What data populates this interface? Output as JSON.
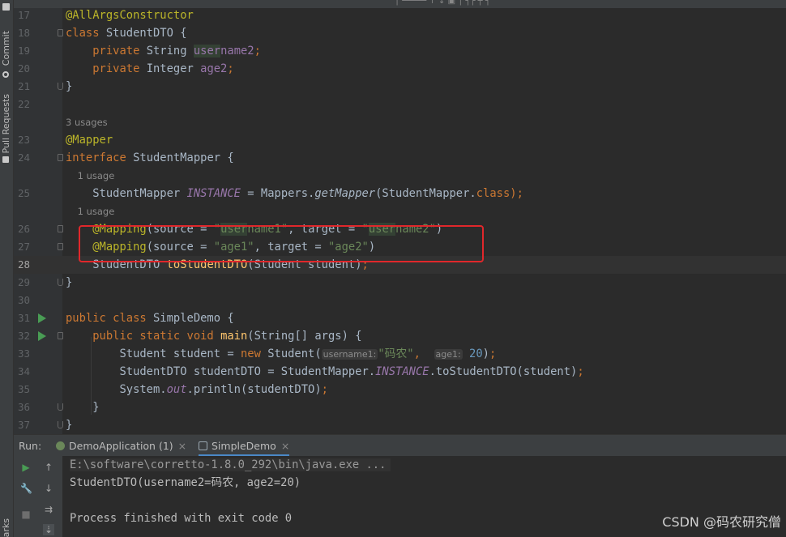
{
  "sidebar": {
    "commit_label": "Commit",
    "pull_requests_label": "Pull Requests",
    "bookmarks_label": "arks"
  },
  "editor": {
    "lines": [
      {
        "num": "17",
        "tokens": [
          {
            "t": "@AllArgsConstructor",
            "c": "ann"
          }
        ]
      },
      {
        "num": "18",
        "tokens": [
          {
            "t": "class ",
            "c": "kw"
          },
          {
            "t": "StudentDTO {"
          }
        ]
      },
      {
        "num": "19",
        "tokens": [
          {
            "t": "    private ",
            "c": "kw"
          },
          {
            "t": "String "
          },
          {
            "t": "user",
            "c": "field hl"
          },
          {
            "t": "name2",
            "c": "field"
          },
          {
            "t": ";",
            "c": "kw"
          }
        ]
      },
      {
        "num": "20",
        "tokens": [
          {
            "t": "    private ",
            "c": "kw"
          },
          {
            "t": "Integer "
          },
          {
            "t": "age2",
            "c": "field"
          },
          {
            "t": ";",
            "c": "kw"
          }
        ]
      },
      {
        "num": "21",
        "tokens": [
          {
            "t": "}"
          }
        ]
      },
      {
        "num": "22",
        "tokens": []
      },
      {
        "hint": "3 usages"
      },
      {
        "num": "23",
        "tokens": [
          {
            "t": "@Mapper",
            "c": "ann"
          }
        ]
      },
      {
        "num": "24",
        "tokens": [
          {
            "t": "interface ",
            "c": "kw"
          },
          {
            "t": "StudentMapper {"
          }
        ]
      },
      {
        "hint": "    1 usage"
      },
      {
        "num": "25",
        "tokens": [
          {
            "t": "    StudentMapper "
          },
          {
            "t": "INSTANCE",
            "c": "static"
          },
          {
            "t": " = Mappers."
          },
          {
            "t": "getMapper",
            "c": "it"
          },
          {
            "t": "(StudentMapper."
          },
          {
            "t": "class",
            "c": "kw"
          },
          {
            "t": ");",
            "c": "kw"
          }
        ]
      },
      {
        "hint": "    1 usage"
      },
      {
        "num": "26",
        "tokens": [
          {
            "t": "    @Mapping",
            "c": "ann"
          },
          {
            "t": "(source = "
          },
          {
            "t": "\"",
            "c": "str"
          },
          {
            "t": "user",
            "c": "str hl"
          },
          {
            "t": "name1\"",
            "c": "str"
          },
          {
            "t": ", target = "
          },
          {
            "t": "\"",
            "c": "str"
          },
          {
            "t": "user",
            "c": "str hl"
          },
          {
            "t": "name2\"",
            "c": "str"
          },
          {
            "t": ")"
          }
        ]
      },
      {
        "num": "27",
        "tokens": [
          {
            "t": "    @Mapping",
            "c": "ann"
          },
          {
            "t": "(source = "
          },
          {
            "t": "\"age1\"",
            "c": "str"
          },
          {
            "t": ", target = "
          },
          {
            "t": "\"age2\"",
            "c": "str"
          },
          {
            "t": ")"
          }
        ]
      },
      {
        "num": "28",
        "tokens": [
          {
            "t": "    StudentDTO "
          },
          {
            "t": "toStudentDTO",
            "c": "fn"
          },
          {
            "t": "(Student student)"
          },
          {
            "t": ";",
            "c": "kw"
          }
        ],
        "current": true
      },
      {
        "num": "29",
        "tokens": [
          {
            "t": "}"
          }
        ]
      },
      {
        "num": "30",
        "tokens": []
      },
      {
        "num": "31",
        "run": true,
        "tokens": [
          {
            "t": "public class ",
            "c": "kw"
          },
          {
            "t": "SimpleDemo {"
          }
        ]
      },
      {
        "num": "32",
        "run": true,
        "tokens": [
          {
            "t": "    public static void ",
            "c": "kw"
          },
          {
            "t": "main",
            "c": "fn"
          },
          {
            "t": "(String[] args) {"
          }
        ]
      },
      {
        "num": "33",
        "tokens": [
          {
            "t": "        Student student = "
          },
          {
            "t": "new ",
            "c": "kw"
          },
          {
            "t": "Student("
          },
          {
            "t": "username1:",
            "c": "inlay"
          },
          {
            "t": "\"码农\"",
            "c": "str"
          },
          {
            "t": ",  ",
            "c": "kw"
          },
          {
            "t": "age1:",
            "c": "inlay"
          },
          {
            "t": " "
          },
          {
            "t": "20",
            "c": "num"
          },
          {
            "t": ")"
          },
          {
            "t": ";",
            "c": "kw"
          }
        ]
      },
      {
        "num": "34",
        "tokens": [
          {
            "t": "        StudentDTO studentDTO = StudentMapper."
          },
          {
            "t": "INSTANCE",
            "c": "static"
          },
          {
            "t": ".toStudentDTO(student)"
          },
          {
            "t": ";",
            "c": "kw"
          }
        ]
      },
      {
        "num": "35",
        "tokens": [
          {
            "t": "        System."
          },
          {
            "t": "out",
            "c": "static"
          },
          {
            "t": ".println(studentDTO)"
          },
          {
            "t": ";",
            "c": "kw"
          }
        ]
      },
      {
        "num": "36",
        "tokens": [
          {
            "t": "    }"
          }
        ]
      },
      {
        "num": "37",
        "tokens": [
          {
            "t": "}"
          }
        ]
      }
    ]
  },
  "run_panel": {
    "label": "Run:",
    "tabs": [
      {
        "label": "DemoApplication (1)",
        "close": "×",
        "active": false
      },
      {
        "label": "SimpleDemo",
        "close": "×",
        "active": true
      }
    ],
    "console": [
      "E:\\software\\corretto-1.8.0_292\\bin\\java.exe ...",
      "StudentDTO(username2=码农, age2=20)",
      "",
      "Process finished with exit code 0"
    ]
  },
  "watermark": "CSDN @码农研究僧",
  "colors": {
    "accent": "#4a88c7",
    "run_green": "#499c54",
    "highlight_box": "#e0272b"
  }
}
